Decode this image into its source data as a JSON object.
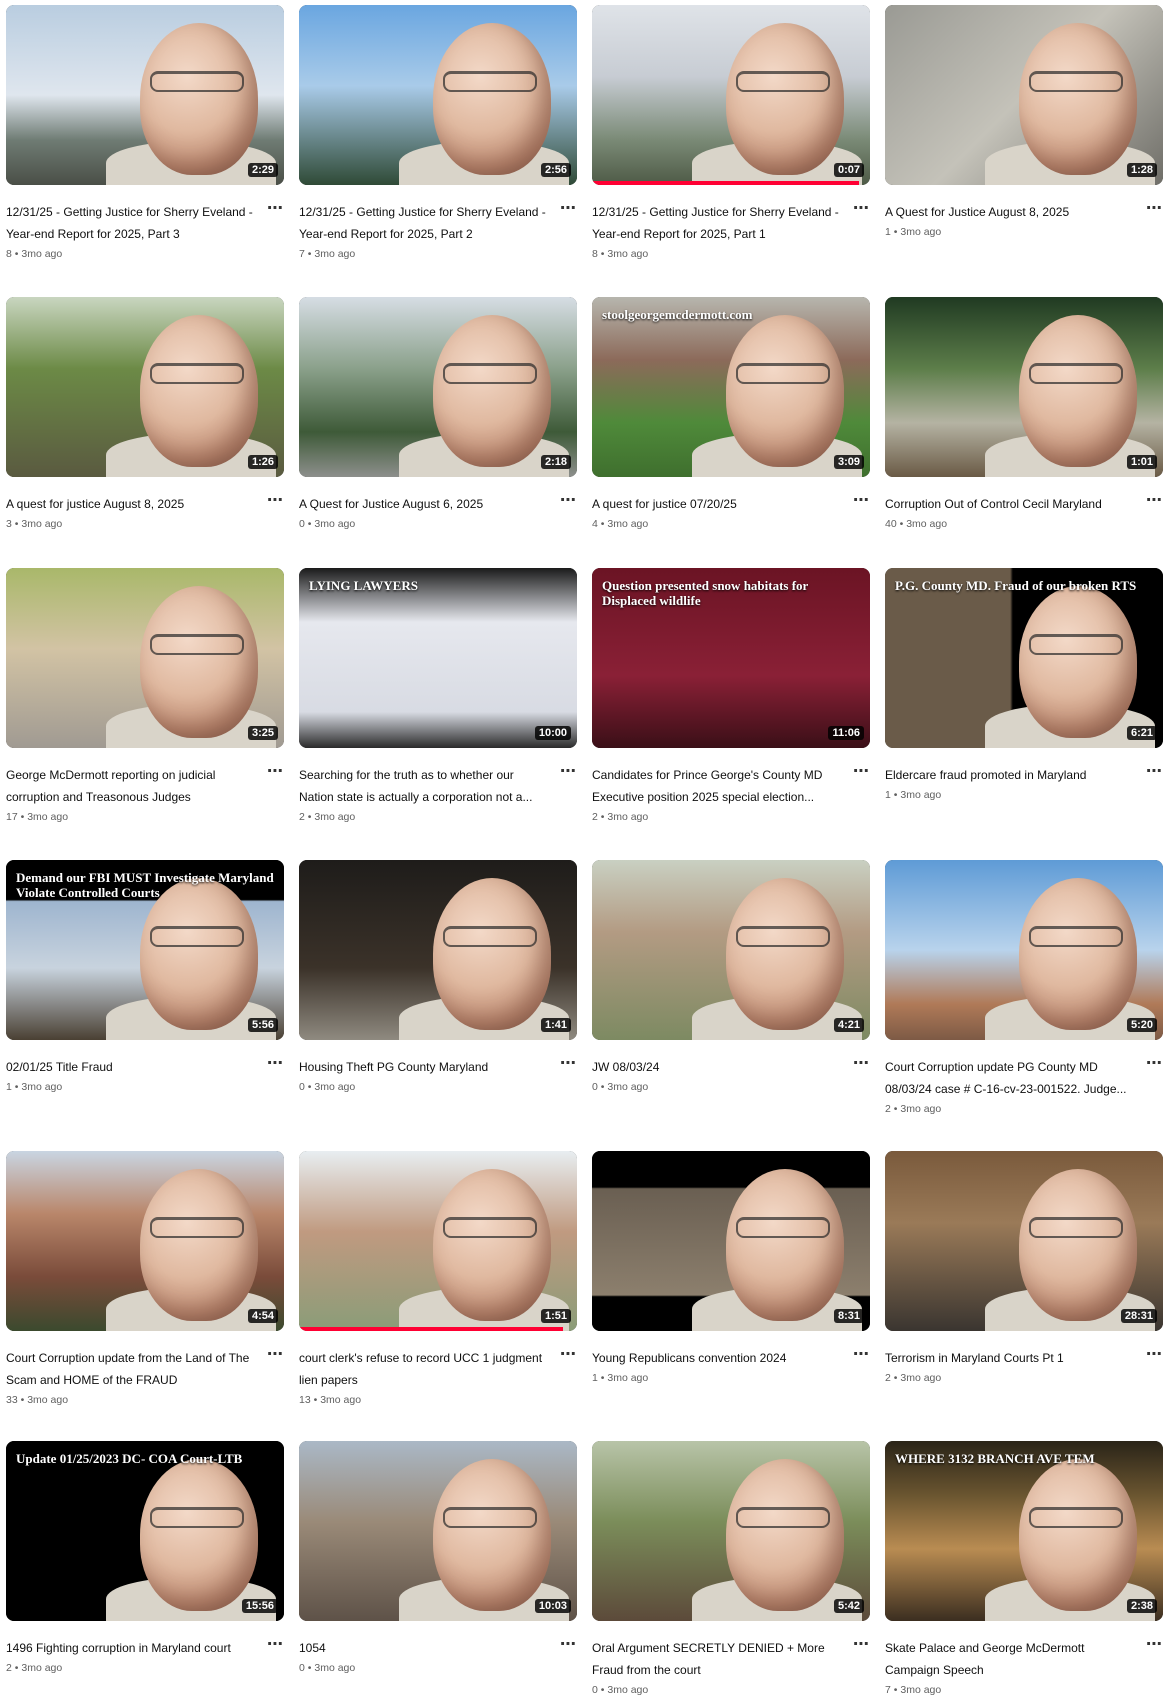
{
  "videos": [
    {
      "title": "12/31/25 - Getting Justice for Sherry Eveland - Year-end Report for 2025, Part 3",
      "views": "8",
      "age": "3mo ago",
      "duration": "2:29",
      "scene": "outdoor-sky",
      "progress": 0
    },
    {
      "title": "12/31/25 - Getting Justice for Sherry Eveland - Year-end Report for 2025, Part 2",
      "views": "7",
      "age": "3mo ago",
      "duration": "2:56",
      "scene": "blue-sky",
      "progress": 0
    },
    {
      "title": "12/31/25 - Getting Justice for Sherry Eveland - Year-end Report for 2025, Part 1",
      "views": "8",
      "age": "3mo ago",
      "duration": "0:07",
      "scene": "house",
      "progress": 0.96
    },
    {
      "title": "A Quest for Justice August 8, 2025",
      "views": "1",
      "age": "3mo ago",
      "duration": "1:28",
      "scene": "shadow",
      "progress": 0
    },
    {
      "title": "A quest for justice August 8, 2025",
      "views": "3",
      "age": "3mo ago",
      "duration": "1:26",
      "scene": "yard",
      "progress": 0
    },
    {
      "title": "A Quest for Justice August 6, 2025",
      "views": "0",
      "age": "3mo ago",
      "duration": "2:18",
      "scene": "trees",
      "progress": 0
    },
    {
      "title": "A quest for justice 07/20/25",
      "views": "4",
      "age": "3mo ago",
      "duration": "3:09",
      "scene": "van-lawn",
      "progress": 0,
      "overlay": "stoolgeorgemcdermott.com"
    },
    {
      "title": "Corruption Out of Control Cecil Maryland",
      "views": "40",
      "age": "3mo ago",
      "duration": "1:01",
      "scene": "woman-yard",
      "progress": 0
    },
    {
      "title": "George McDermott reporting on judicial corruption and Treasonous Judges",
      "views": "17",
      "age": "3mo ago",
      "duration": "3:25",
      "scene": "street",
      "progress": 0
    },
    {
      "title": "Searching for the truth as to whether our Nation state is actually a corporation not a...",
      "views": "2",
      "age": "3mo ago",
      "duration": "10:00",
      "scene": "white-van",
      "progress": 0,
      "overlay": "LYING LAWYERS"
    },
    {
      "title": "Candidates for Prince George's County MD Executive position 2025 special election...",
      "views": "2",
      "age": "3mo ago",
      "duration": "11:06",
      "scene": "stage",
      "progress": 0,
      "overlay": "Question presented snow habitats for Displaced wildlife"
    },
    {
      "title": "Eldercare fraud promoted in Maryland",
      "views": "1",
      "age": "3mo ago",
      "duration": "6:21",
      "scene": "black-text",
      "progress": 0,
      "overlay": "P.G. County MD. Fraud of our broken RTS"
    },
    {
      "title": "02/01/25 Title Fraud",
      "views": "1",
      "age": "3mo ago",
      "duration": "5:56",
      "scene": "black-text-2",
      "progress": 0,
      "overlay": "Demand our FBI MUST Investigate Maryland Violate Controlled Courts"
    },
    {
      "title": "Housing Theft PG County Maryland",
      "views": "0",
      "age": "3mo ago",
      "duration": "1:41",
      "scene": "night",
      "progress": 0
    },
    {
      "title": "JW 08/03/24",
      "views": "0",
      "age": "3mo ago",
      "duration": "4:21",
      "scene": "street-2",
      "progress": 0
    },
    {
      "title": "Court Corruption update PG County MD 08/03/24 case # C-16-cv-23-001522. Judge...",
      "views": "2",
      "age": "3mo ago",
      "duration": "5:20",
      "scene": "blue-sky-2",
      "progress": 0
    },
    {
      "title": "Court Corruption update from the Land of The Scam and HOME of the FRAUD",
      "views": "33",
      "age": "3mo ago",
      "duration": "4:54",
      "scene": "courthouse",
      "progress": 0
    },
    {
      "title": "court clerk's refuse to record UCC 1 judgment lien papers",
      "views": "13",
      "age": "3mo ago",
      "duration": "1:51",
      "scene": "building",
      "progress": 0.95
    },
    {
      "title": "Young Republicans convention 2024",
      "views": "1",
      "age": "3mo ago",
      "duration": "8:31",
      "scene": "flags",
      "progress": 0
    },
    {
      "title": "Terrorism in Maryland Courts Pt 1",
      "views": "2",
      "age": "3mo ago",
      "duration": "28:31",
      "scene": "room",
      "progress": 0
    },
    {
      "title": "1496 Fighting corruption in Maryland court",
      "views": "2",
      "age": "3mo ago",
      "duration": "15:56",
      "scene": "court-text",
      "progress": 0,
      "overlay": "Update 01/25/2023 DC- COA Court-LTB"
    },
    {
      "title": "1054",
      "views": "0",
      "age": "3mo ago",
      "duration": "10:03",
      "scene": "city",
      "progress": 0
    },
    {
      "title": "Oral Argument SECRETLY DENIED + More Fraud from the court",
      "views": "0",
      "age": "3mo ago",
      "duration": "5:42",
      "scene": "flag-street",
      "progress": 0
    },
    {
      "title": "Skate Palace and George McDermott Campaign Speech",
      "views": "7",
      "age": "3mo ago",
      "duration": "2:38",
      "scene": "skate",
      "progress": 0,
      "overlay": "WHERE 3132 BRANCH AVE TEM"
    }
  ],
  "more_icon": "⋯",
  "separator": " • "
}
